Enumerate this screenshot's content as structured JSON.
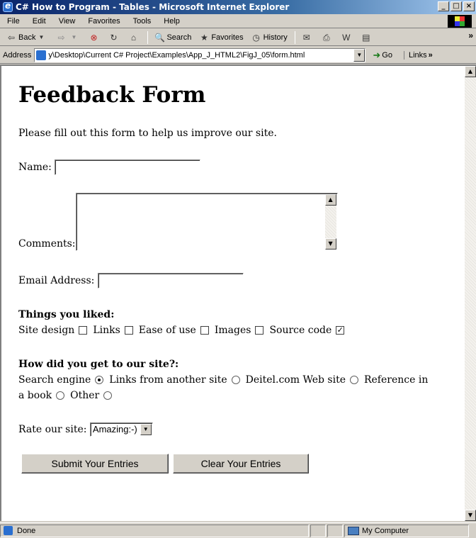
{
  "window": {
    "title": "C# How to Program - Tables - Microsoft Internet Explorer"
  },
  "menu": [
    "File",
    "Edit",
    "View",
    "Favorites",
    "Tools",
    "Help"
  ],
  "toolbar": {
    "back": "Back",
    "search": "Search",
    "favorites": "Favorites",
    "history": "History"
  },
  "address": {
    "label": "Address",
    "value": "y\\Desktop\\Current C# Project\\Examples\\App_J_HTML2\\FigJ_05\\form.html",
    "go": "Go",
    "links": "Links"
  },
  "page": {
    "heading": "Feedback Form",
    "intro": "Please fill out this form to help us improve our site.",
    "name_label": "Name:",
    "name_value": "",
    "comments_label": "Comments:",
    "comments_value": "",
    "email_label": "Email Address:",
    "email_value": "",
    "liked_heading": "Things you liked:",
    "liked": [
      {
        "label": "Site design",
        "checked": false
      },
      {
        "label": "Links",
        "checked": false
      },
      {
        "label": "Ease of use",
        "checked": false
      },
      {
        "label": "Images",
        "checked": false
      },
      {
        "label": "Source code",
        "checked": true
      }
    ],
    "how_heading": "How did you get to our site?:",
    "how": [
      {
        "label": "Search engine",
        "selected": true
      },
      {
        "label": "Links from another site",
        "selected": false
      },
      {
        "label": "Deitel.com Web site",
        "selected": false
      },
      {
        "label": "Reference in",
        "selected": false
      },
      {
        "label": "a book",
        "selected": false
      },
      {
        "label": "Other",
        "selected": false
      }
    ],
    "rate_label": "Rate our site:",
    "rate_value": "Amazing:-)",
    "submit": "Submit Your Entries",
    "clear": "Clear Your Entries"
  },
  "status": {
    "text": "Done",
    "zone": "My Computer"
  }
}
